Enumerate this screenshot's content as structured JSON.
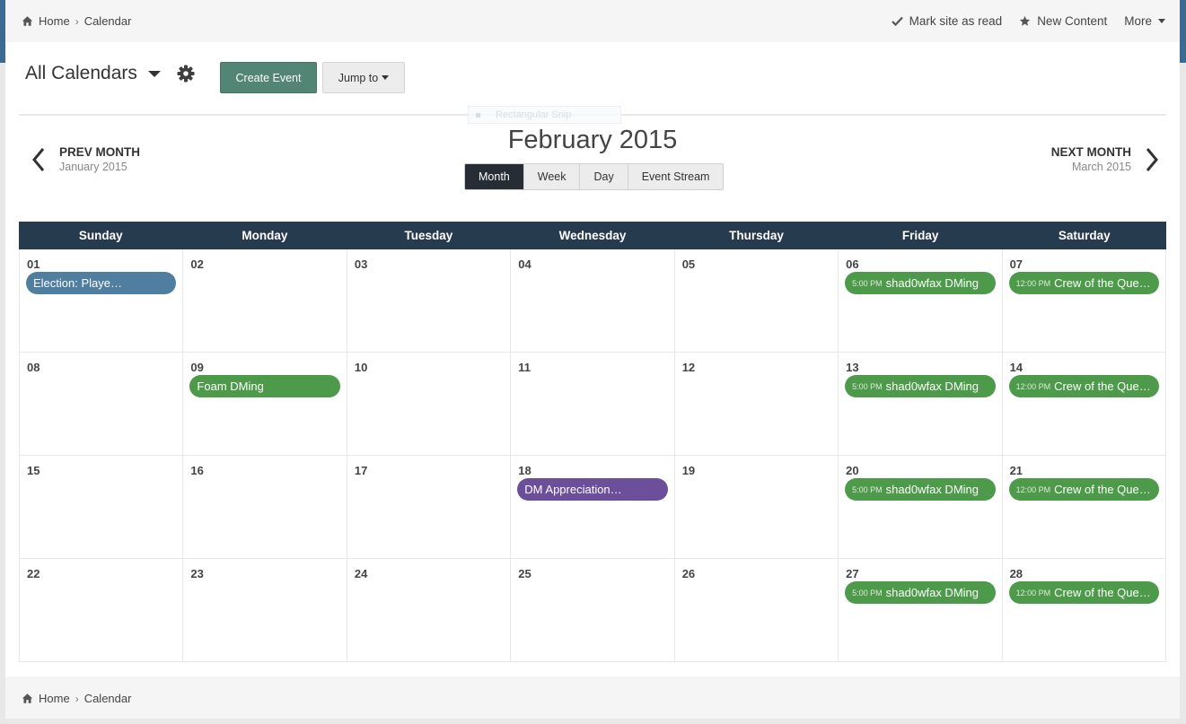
{
  "breadcrumb": {
    "home": "Home",
    "current": "Calendar"
  },
  "user_links": {
    "mark_read": "Mark site as read",
    "new_content": "New Content",
    "more": "More"
  },
  "header": {
    "title": "All Calendars",
    "create_event": "Create Event",
    "jump_to": "Jump to"
  },
  "overlay": {
    "snip_label": "Rectangular Snip"
  },
  "nav": {
    "month_title": "February 2015",
    "prev_label": "PREV MONTH",
    "prev_month": "January 2015",
    "next_label": "NEXT MONTH",
    "next_month": "March 2015"
  },
  "views": [
    "Month",
    "Week",
    "Day",
    "Event Stream"
  ],
  "active_view": "Month",
  "weekdays": [
    "Sunday",
    "Monday",
    "Tuesday",
    "Wednesday",
    "Thursday",
    "Friday",
    "Saturday"
  ],
  "colors": {
    "blue_event": "#4f7ea0",
    "green_event": "#4d9a4b",
    "purple_event": "#6b4f9a",
    "header_bg": "#263b4e",
    "create_button": "#528573"
  },
  "days": [
    {
      "num": "01",
      "events": [
        {
          "title": "Election: Playe…",
          "color": "#4f7ea0"
        }
      ]
    },
    {
      "num": "02",
      "events": []
    },
    {
      "num": "03",
      "events": []
    },
    {
      "num": "04",
      "events": []
    },
    {
      "num": "05",
      "events": []
    },
    {
      "num": "06",
      "events": [
        {
          "time": "5:00 PM",
          "title": "shad0wfax DMing",
          "color": "#4d9a4b"
        }
      ]
    },
    {
      "num": "07",
      "events": [
        {
          "time": "12:00 PM",
          "title": "Crew of the Que…",
          "color": "#4d9a4b"
        }
      ]
    },
    {
      "num": "08",
      "events": []
    },
    {
      "num": "09",
      "events": [
        {
          "title": "Foam DMing",
          "color": "#4d9a4b"
        }
      ]
    },
    {
      "num": "10",
      "events": []
    },
    {
      "num": "11",
      "events": []
    },
    {
      "num": "12",
      "events": []
    },
    {
      "num": "13",
      "events": [
        {
          "time": "5:00 PM",
          "title": "shad0wfax DMing",
          "color": "#4d9a4b"
        }
      ]
    },
    {
      "num": "14",
      "events": [
        {
          "time": "12:00 PM",
          "title": "Crew of the Que…",
          "color": "#4d9a4b"
        }
      ]
    },
    {
      "num": "15",
      "events": []
    },
    {
      "num": "16",
      "events": []
    },
    {
      "num": "17",
      "events": []
    },
    {
      "num": "18",
      "events": [
        {
          "title": "DM Appreciation…",
          "color": "#6b4f9a"
        }
      ]
    },
    {
      "num": "19",
      "events": []
    },
    {
      "num": "20",
      "events": [
        {
          "time": "5:00 PM",
          "title": "shad0wfax DMing",
          "color": "#4d9a4b"
        }
      ]
    },
    {
      "num": "21",
      "events": [
        {
          "time": "12:00 PM",
          "title": "Crew of the Que…",
          "color": "#4d9a4b"
        }
      ]
    },
    {
      "num": "22",
      "events": []
    },
    {
      "num": "23",
      "events": []
    },
    {
      "num": "24",
      "events": []
    },
    {
      "num": "25",
      "events": []
    },
    {
      "num": "26",
      "events": []
    },
    {
      "num": "27",
      "events": [
        {
          "time": "5:00 PM",
          "title": "shad0wfax DMing",
          "color": "#4d9a4b"
        }
      ]
    },
    {
      "num": "28",
      "events": [
        {
          "time": "12:00 PM",
          "title": "Crew of the Que…",
          "color": "#4d9a4b"
        }
      ]
    }
  ]
}
